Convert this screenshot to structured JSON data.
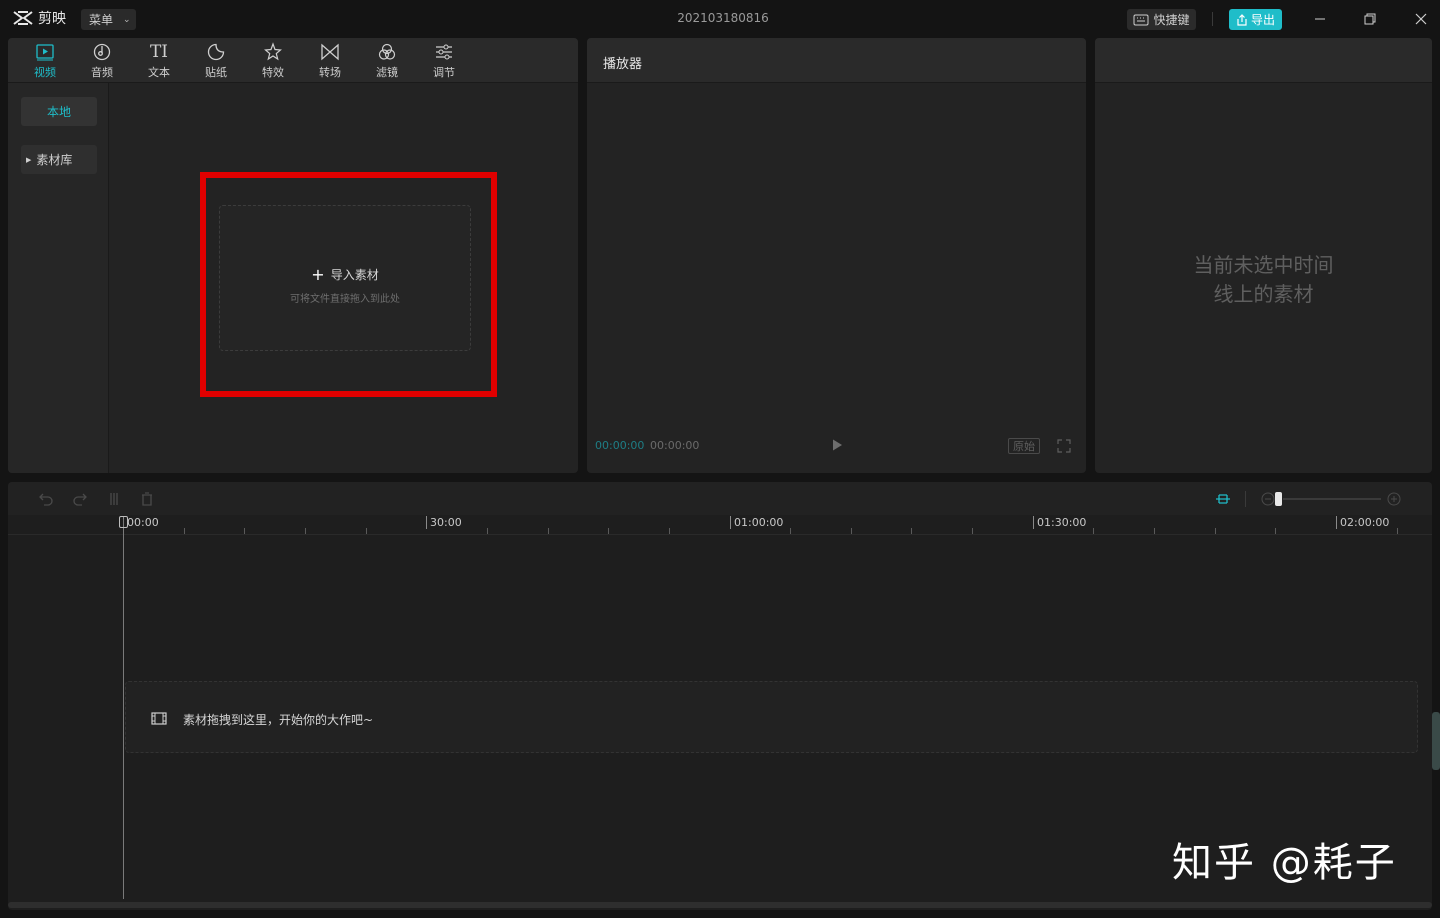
{
  "titlebar": {
    "app_name": "剪映",
    "menu_label": "菜单",
    "doc_title": "202103180816",
    "shortcut_label": "快捷键",
    "export_label": "导出"
  },
  "toolbar": {
    "tabs": [
      {
        "label": "视频",
        "icon": "video-icon",
        "active": true
      },
      {
        "label": "音频",
        "icon": "audio-icon"
      },
      {
        "label": "文本",
        "icon": "text-icon",
        "glyph": "TI"
      },
      {
        "label": "贴纸",
        "icon": "sticker-icon"
      },
      {
        "label": "特效",
        "icon": "effects-icon"
      },
      {
        "label": "转场",
        "icon": "transition-icon"
      },
      {
        "label": "滤镜",
        "icon": "filter-icon"
      },
      {
        "label": "调节",
        "icon": "adjust-icon"
      }
    ]
  },
  "sidebar": {
    "local_label": "本地",
    "library_label": "素材库"
  },
  "media": {
    "import_label": "导入素材",
    "import_hint": "可将文件直接拖入到此处"
  },
  "player": {
    "title": "播放器",
    "current_time": "00:00:00",
    "total_time": "00:00:00",
    "ratio_label": "原始"
  },
  "properties": {
    "empty_line1": "当前未选中时间",
    "empty_line2": "线上的素材"
  },
  "timeline": {
    "ruler_labels": [
      "00:00",
      "30:00",
      "01:00:00",
      "01:30:00",
      "02:00:00"
    ],
    "drop_hint": "素材拖拽到这里，开始你的大作吧~"
  },
  "watermark": "知乎 @耗子",
  "colors": {
    "accent": "#1fbdc9",
    "highlight_frame": "#e00000",
    "panel_bg": "#232323",
    "app_bg": "#141414"
  }
}
